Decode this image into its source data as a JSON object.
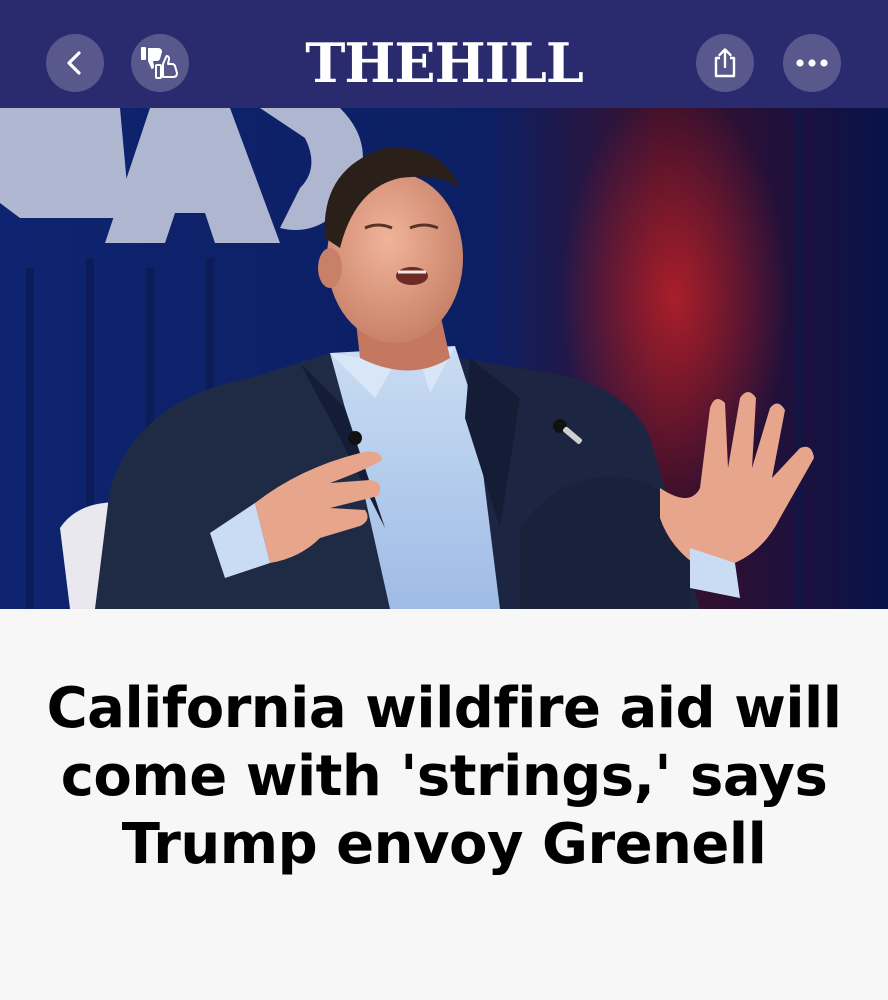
{
  "header": {
    "logo_text": "THEHILL",
    "background_color": "#2a2a6e",
    "buttons": [
      {
        "name": "back",
        "icon": "chevron-left-icon"
      },
      {
        "name": "reaction",
        "icon": "thumbs-down-up-icon"
      },
      {
        "name": "share",
        "icon": "share-icon"
      },
      {
        "name": "more",
        "icon": "ellipsis-icon"
      }
    ]
  },
  "article": {
    "hero_image": "photo of a man in a dark suit and light blue shirt seated on stage gesturing while speaking, CPAC backdrop",
    "headline": "California wildfire aid will come with 'strings,' says Trump envoy Grenell"
  }
}
